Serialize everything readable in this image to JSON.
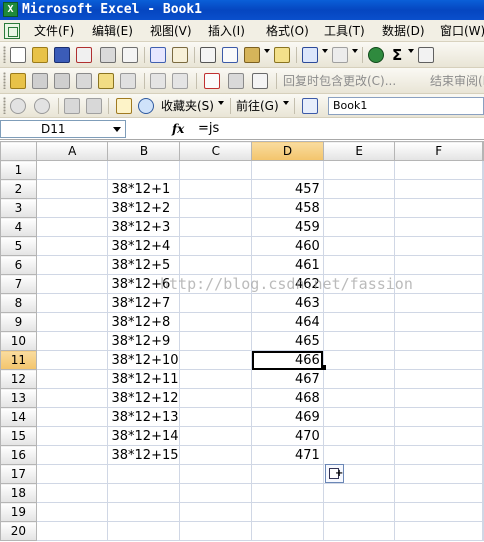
{
  "window": {
    "icon_letter": "X",
    "title": "Microsoft Excel - Book1"
  },
  "menu": {
    "items": [
      "文件(F)",
      "编辑(E)",
      "视图(V)",
      "插入(I)",
      "格式(O)",
      "工具(T)",
      "数据(D)",
      "窗口(W)"
    ]
  },
  "toolbar2": {
    "reply_with_changes": "回复时包含更改(C)...",
    "end_review": "结束审阅(N)"
  },
  "toolbar3": {
    "favorites": "收藏夹(S)",
    "go": "前往(G)",
    "address": "Book1"
  },
  "formula_bar": {
    "name_box": "D11",
    "fx": "fx",
    "formula": "=js"
  },
  "sheet": {
    "columns": [
      "A",
      "B",
      "C",
      "D",
      "E",
      "F"
    ],
    "selected_column": "D",
    "selected_row": 11,
    "rows": [
      {
        "row": 1,
        "b": "",
        "d": ""
      },
      {
        "row": 2,
        "b": "38*12+1",
        "d": "457"
      },
      {
        "row": 3,
        "b": "38*12+2",
        "d": "458"
      },
      {
        "row": 4,
        "b": "38*12+3",
        "d": "459"
      },
      {
        "row": 5,
        "b": "38*12+4",
        "d": "460"
      },
      {
        "row": 6,
        "b": "38*12+5",
        "d": "461"
      },
      {
        "row": 7,
        "b": "38*12+6",
        "d": "462"
      },
      {
        "row": 8,
        "b": "38*12+7",
        "d": "463"
      },
      {
        "row": 9,
        "b": "38*12+8",
        "d": "464"
      },
      {
        "row": 10,
        "b": "38*12+9",
        "d": "465"
      },
      {
        "row": 11,
        "b": "38*12+10",
        "d": "466"
      },
      {
        "row": 12,
        "b": "38*12+11",
        "d": "467"
      },
      {
        "row": 13,
        "b": "38*12+12",
        "d": "468"
      },
      {
        "row": 14,
        "b": "38*12+13",
        "d": "469"
      },
      {
        "row": 15,
        "b": "38*12+14",
        "d": "470"
      },
      {
        "row": 16,
        "b": "38*12+15",
        "d": "471"
      },
      {
        "row": 17,
        "b": "",
        "d": ""
      },
      {
        "row": 18,
        "b": "",
        "d": ""
      },
      {
        "row": 19,
        "b": "",
        "d": ""
      },
      {
        "row": 20,
        "b": "",
        "d": ""
      }
    ]
  },
  "watermark": "http://blog.csdn.net/fassion",
  "colors": {
    "title_bar": "#0a5fd8",
    "selection_header": "#f3c46b",
    "grid_line": "#d0d7e5"
  }
}
